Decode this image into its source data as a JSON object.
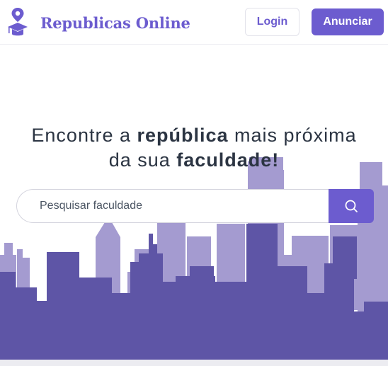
{
  "header": {
    "brand_name": "Republicas Online",
    "login_label": "Login",
    "anunciar_label": "Anunciar",
    "logo_icon": "map-pin-graduation-cap-icon"
  },
  "hero": {
    "title_part1": "Encontre a ",
    "title_bold1": "república",
    "title_part2": " mais próxima",
    "title_part3": "da sua ",
    "title_bold2": "faculdade!"
  },
  "search": {
    "placeholder": "Pesquisar faculdade",
    "value": "",
    "button_icon": "search-icon"
  },
  "colors": {
    "brand": "#6c5ccf",
    "skyline_back": "#a49bd0",
    "skyline_front": "#5e55a6",
    "text": "#2b3442"
  }
}
